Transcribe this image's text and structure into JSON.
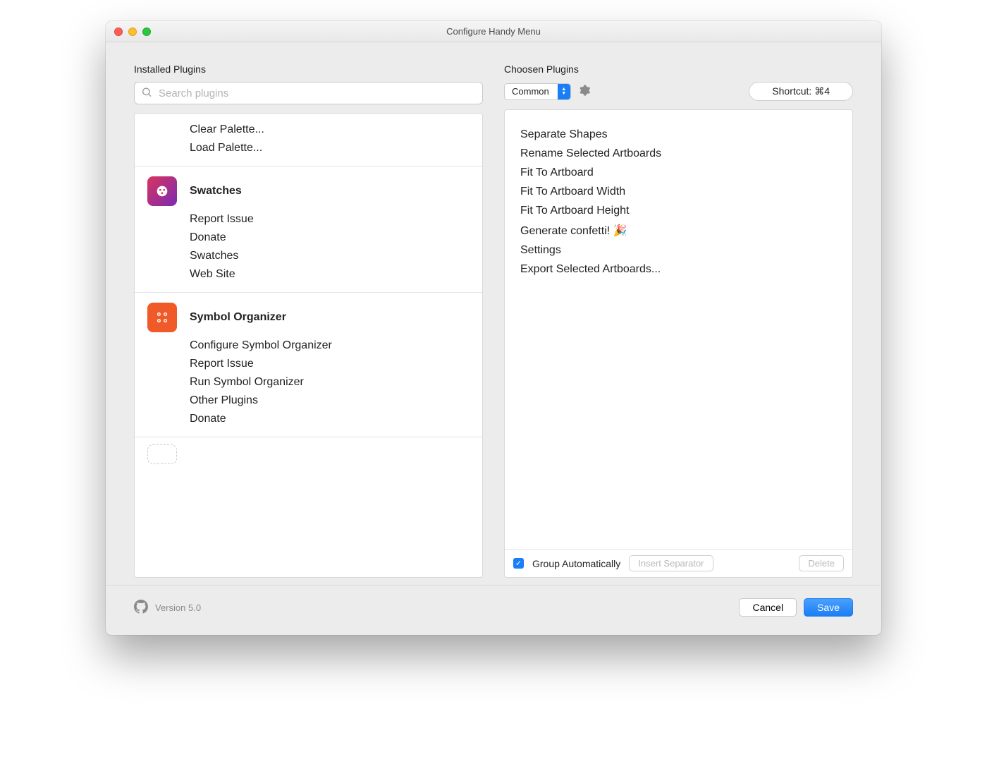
{
  "window": {
    "title": "Configure Handy Menu"
  },
  "left": {
    "heading": "Installed Plugins",
    "search_placeholder": "Search plugins",
    "groups": [
      {
        "has_header": false,
        "items": [
          "Clear Palette...",
          "Load Palette..."
        ]
      },
      {
        "has_header": true,
        "title": "Swatches",
        "icon": "swatches",
        "items": [
          "Report Issue",
          "Donate",
          "Swatches",
          "Web Site"
        ]
      },
      {
        "has_header": true,
        "title": "Symbol Organizer",
        "icon": "symbol-organizer",
        "items": [
          "Configure Symbol Organizer",
          "Report Issue",
          "Run Symbol Organizer",
          "Other Plugins",
          "Donate"
        ]
      }
    ]
  },
  "right": {
    "heading": "Choosen Plugins",
    "dropdown_value": "Common",
    "shortcut_label": "Shortcut: ⌘4",
    "items": [
      "Separate Shapes",
      "Rename Selected Artboards",
      "Fit To Artboard",
      "Fit To Artboard Width",
      "Fit To Artboard Height",
      "Generate confetti! 🎉",
      "Settings",
      "Export Selected Artboards..."
    ],
    "group_auto_label": "Group Automatically",
    "insert_separator_label": "Insert Separator",
    "delete_label": "Delete"
  },
  "footer": {
    "version": "Version 5.0",
    "cancel": "Cancel",
    "save": "Save"
  }
}
